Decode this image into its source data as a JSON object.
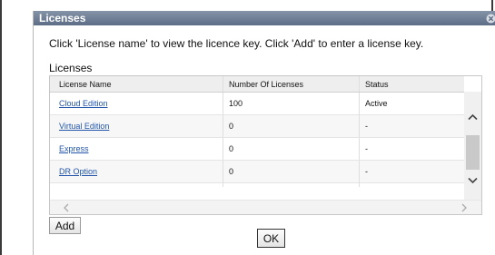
{
  "dialog": {
    "title": "Licenses",
    "close_icon": "close-icon"
  },
  "instruction": "Click 'License name' to view the licence key. Click 'Add' to enter a license key.",
  "section_label": "Licenses",
  "table": {
    "columns": [
      "License Name",
      "Number Of Licenses",
      "Status"
    ],
    "rows": [
      {
        "name": "Cloud Edition",
        "count": "100",
        "status": "Active"
      },
      {
        "name": "Virtual Edition",
        "count": "0",
        "status": "-"
      },
      {
        "name": "Express",
        "count": "0",
        "status": "-"
      },
      {
        "name": "DR Option",
        "count": "0",
        "status": "-"
      }
    ]
  },
  "scrollbars": {
    "vertical_up_icon": "chevron-up-icon",
    "vertical_down_icon": "chevron-down-icon",
    "horizontal_left_icon": "chevron-left-icon",
    "horizontal_right_icon": "chevron-right-icon"
  },
  "buttons": {
    "add": "Add",
    "ok": "OK"
  },
  "colors": {
    "titlebar": "#6f7e96",
    "link": "#2255aa"
  }
}
